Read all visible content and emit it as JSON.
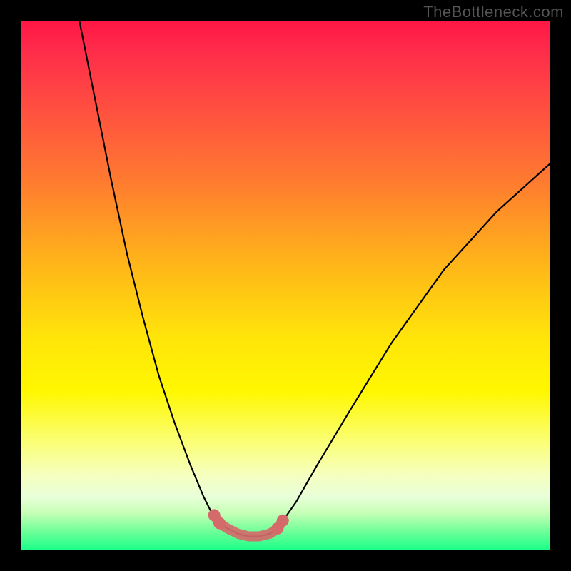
{
  "watermark": "TheBottleneck.com",
  "colors": {
    "frame_bg": "#000000",
    "curve_stroke": "#000000",
    "highlight_stroke": "#d46a6a",
    "gradient_stops": [
      {
        "offset": 0.0,
        "color": "#ff1744"
      },
      {
        "offset": 0.05,
        "color": "#ff2a4a"
      },
      {
        "offset": 0.15,
        "color": "#ff4a42"
      },
      {
        "offset": 0.3,
        "color": "#ff7a30"
      },
      {
        "offset": 0.45,
        "color": "#ffb21a"
      },
      {
        "offset": 0.6,
        "color": "#ffe50a"
      },
      {
        "offset": 0.7,
        "color": "#fff700"
      },
      {
        "offset": 0.8,
        "color": "#faff7a"
      },
      {
        "offset": 0.86,
        "color": "#f5ffc0"
      },
      {
        "offset": 0.9,
        "color": "#e8ffd8"
      },
      {
        "offset": 0.93,
        "color": "#c8ffb8"
      },
      {
        "offset": 0.96,
        "color": "#7cff9c"
      },
      {
        "offset": 1.0,
        "color": "#1cff88"
      }
    ]
  },
  "chart_data": {
    "type": "line",
    "title": "",
    "xlabel": "",
    "ylabel": "",
    "xlim": [
      0,
      100
    ],
    "ylim": [
      0,
      100
    ],
    "series": [
      {
        "name": "left_branch",
        "x": [
          11,
          14,
          17,
          20,
          23,
          26,
          29,
          32,
          34.5,
          36,
          37.5,
          39
        ],
        "y": [
          100,
          85,
          70,
          56,
          44,
          33,
          24,
          16,
          10,
          7,
          5,
          4
        ]
      },
      {
        "name": "trough",
        "x": [
          39,
          41,
          43,
          45,
          47,
          48.5
        ],
        "y": [
          4,
          3,
          2.5,
          2.5,
          3,
          4
        ]
      },
      {
        "name": "right_branch",
        "x": [
          48.5,
          52,
          56,
          62,
          70,
          80,
          90,
          100
        ],
        "y": [
          4,
          9,
          16,
          26,
          39,
          53,
          64,
          73
        ]
      }
    ],
    "highlight": {
      "name": "trough_highlight",
      "x": [
        36.5,
        37.5,
        39,
        41,
        43,
        45,
        47,
        48.5,
        49.5
      ],
      "y": [
        6.5,
        5,
        4,
        3,
        2.5,
        2.5,
        3,
        4,
        5.5
      ]
    }
  }
}
